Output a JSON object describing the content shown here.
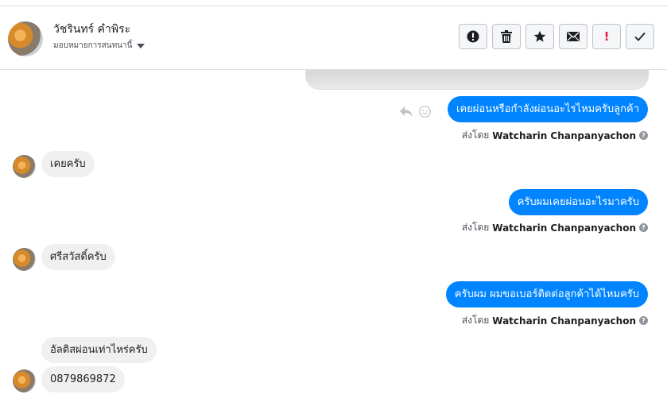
{
  "header": {
    "contact_name": "วัชรินทร์ คำพิระ",
    "assign_label": "มอบหมายการสนทนานี้"
  },
  "actions": [
    {
      "name": "mark-important",
      "icon": "exclamation-circle-icon"
    },
    {
      "name": "delete",
      "icon": "trash-icon"
    },
    {
      "name": "star",
      "icon": "star-icon"
    },
    {
      "name": "mark-unread",
      "icon": "envelope-icon"
    },
    {
      "name": "spam",
      "icon": "exclamation-icon",
      "label": "!"
    },
    {
      "name": "done",
      "icon": "check-icon"
    }
  ],
  "messages": [
    {
      "direction": "out",
      "text": "เคยผ่อนหรือกำลังผ่อนอะไรไหมครับลูกค้า",
      "sent_by_prefix": "ส่งโดย",
      "sent_by_name": "Watcharin Chanpanyachon"
    },
    {
      "direction": "in",
      "text": "เคยครับ"
    },
    {
      "direction": "out",
      "text": "ครับผมเคยผ่อนอะไรมาครับ",
      "sent_by_prefix": "ส่งโดย",
      "sent_by_name": "Watcharin Chanpanyachon"
    },
    {
      "direction": "in",
      "text": "ศรีสวัสดิ์ครับ"
    },
    {
      "direction": "out",
      "text": "ครับผม ผมขอเบอร์ติดต่อลูกค้าได้ไหมครับ",
      "sent_by_prefix": "ส่งโดย",
      "sent_by_name": "Watcharin Chanpanyachon"
    },
    {
      "direction": "in",
      "text": "อัลติสผ่อนเท่าไหร่ครับ"
    },
    {
      "direction": "in",
      "text": "0879869872"
    }
  ],
  "info_glyph": "?"
}
